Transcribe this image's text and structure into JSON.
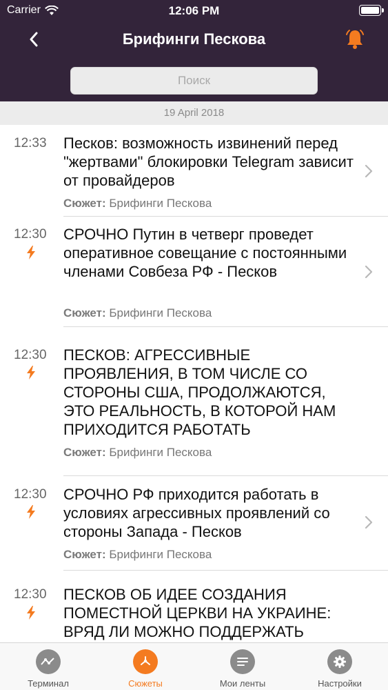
{
  "status_bar": {
    "carrier": "Carrier",
    "time": "12:06 PM"
  },
  "nav": {
    "title": "Брифинги Пескова"
  },
  "search": {
    "placeholder": "Поиск"
  },
  "date_header": "19 April 2018",
  "items": [
    {
      "time": "12:33",
      "urgent": false,
      "title": "Песков: возможность извинений перед \"жертвами\" блокировки Telegram зависит от провайдеров",
      "meta_label": "Сюжет:",
      "meta_value": "Брифинги Пескова"
    },
    {
      "time": "12:30",
      "urgent": true,
      "title": "СРОЧНО Путин в четверг проведет оперативное совещание с постоянными членами Совбеза РФ - Песков",
      "meta_label": "Сюжет:",
      "meta_value": "Брифинги Пескова"
    },
    {
      "time": "12:30",
      "urgent": true,
      "title": "ПЕСКОВ: АГРЕССИВНЫЕ ПРОЯВЛЕНИЯ, В ТОМ ЧИСЛЕ СО СТОРОНЫ США, ПРОДОЛЖАЮТСЯ, ЭТО РЕАЛЬНОСТЬ, В КОТОРОЙ НАМ ПРИХОДИТСЯ РАБОТАТЬ",
      "meta_label": "Сюжет:",
      "meta_value": "Брифинги Пескова"
    },
    {
      "time": "12:30",
      "urgent": true,
      "title": "СРОЧНО РФ приходится работать в условиях агрессивных проявлений со стороны Запада - Песков",
      "meta_label": "Сюжет:",
      "meta_value": "Брифинги Пескова"
    },
    {
      "time": "12:30",
      "urgent": true,
      "title": "ПЕСКОВ ОБ ИДЕЕ СОЗДАНИЯ ПОМЕСТНОЙ ЦЕРКВИ НА УКРАИНЕ: ВРЯД ЛИ МОЖНО ПОДДЕРЖАТЬ",
      "meta_label": "",
      "meta_value": ""
    }
  ],
  "tabs": [
    {
      "label": "Терминал",
      "icon": "terminal-icon",
      "active": false
    },
    {
      "label": "Сюжеты",
      "icon": "stories-icon",
      "active": true
    },
    {
      "label": "Мои ленты",
      "icon": "feeds-icon",
      "active": false
    },
    {
      "label": "Настройки",
      "icon": "gear-icon",
      "active": false
    }
  ],
  "colors": {
    "header_bg": "#33243a",
    "accent": "#f47b20"
  }
}
